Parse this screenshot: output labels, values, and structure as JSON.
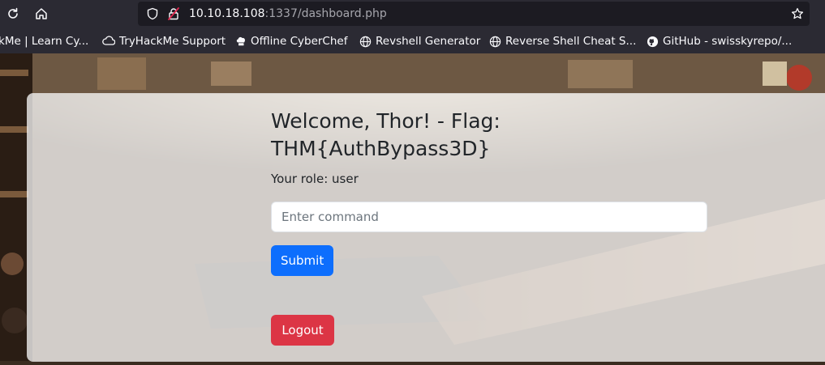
{
  "browser": {
    "url_host": "10.10.18.108",
    "url_rest": ":1337/dashboard.php",
    "bookmarks": [
      {
        "label": "kMe | Learn Cy...",
        "icon": "thm-icon"
      },
      {
        "label": "TryHackMe Support",
        "icon": "cloud-icon"
      },
      {
        "label": "Offline CyberChef",
        "icon": "chef-hat-icon"
      },
      {
        "label": "Revshell Generator",
        "icon": "globe-icon"
      },
      {
        "label": "Reverse Shell Cheat S...",
        "icon": "globe-icon"
      },
      {
        "label": "GitHub - swisskyrepo/...",
        "icon": "github-icon"
      }
    ]
  },
  "page": {
    "welcome_heading": "Welcome, Thor! - Flag: THM{AuthBypass3D}",
    "role_text": "Your role: user",
    "command_placeholder": "Enter command",
    "submit_label": "Submit",
    "logout_label": "Logout"
  },
  "colors": {
    "primary": "#0d6efd",
    "danger": "#dc3545",
    "toolbar": "#2b2a33",
    "insecure": "#e22850"
  }
}
